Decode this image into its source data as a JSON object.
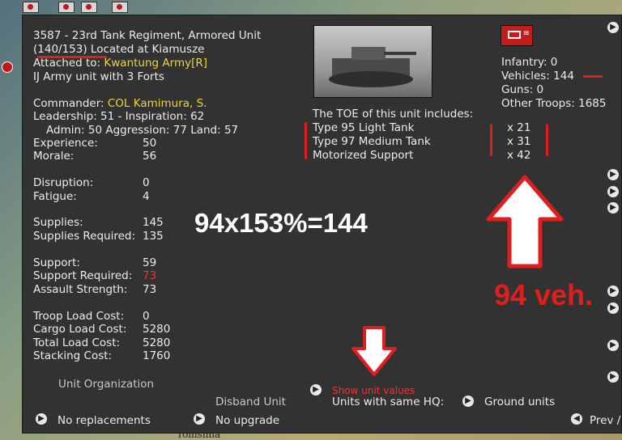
{
  "unit": {
    "line1": "3587 - 23rd Tank Regiment, Armored Unit",
    "line2_strength": "(140/153)",
    "line2_rest": " Located at  Kiamusze",
    "attached_label": "Attached to: ",
    "attached_value": "Kwantung Army[R]",
    "line4": "IJ Army unit with 3 Forts"
  },
  "commander": {
    "label": "Commander: ",
    "value": "COL Kamimura, S.",
    "leadership": "Leadership: 51 - Inspiration: 62",
    "admin": "Admin: 50  Aggression: 77  Land: 57"
  },
  "stats": [
    {
      "label": "Experience:",
      "value": "50"
    },
    {
      "label": "Morale:",
      "value": "56"
    },
    {
      "label": "Disruption:",
      "value": "0"
    },
    {
      "label": "Fatigue:",
      "value": "4"
    },
    {
      "label": "Supplies:",
      "value": "145"
    },
    {
      "label": "Supplies Required:",
      "value": "135"
    },
    {
      "label": "Support:",
      "value": "59"
    },
    {
      "label": "Support Required:",
      "value": "73"
    },
    {
      "label": "Assault Strength:",
      "value": "73"
    },
    {
      "label": "Troop Load Cost:",
      "value": "0"
    },
    {
      "label": "Cargo Load Cost:",
      "value": "5280"
    },
    {
      "label": "Total Load Cost:",
      "value": "5280"
    },
    {
      "label": "Stacking Cost:",
      "value": "1760"
    }
  ],
  "troops": {
    "infantry": "Infantry: 0",
    "vehicles": "Vehicles: 144",
    "guns": "Guns: 0",
    "other": "Other Troops: 1685"
  },
  "toe": {
    "heading": "The TOE of this unit includes:",
    "items": [
      {
        "name": "Type 95 Light Tank",
        "count": "x 21"
      },
      {
        "name": "Type 97 Medium Tank",
        "count": "x 31"
      },
      {
        "name": "Motorized Support",
        "count": "x 42"
      }
    ]
  },
  "annotations": {
    "formula": "94x153%=144",
    "veh": "94 veh."
  },
  "bottom": {
    "unit_org": "Unit Organization",
    "show_values": "Show unit values",
    "disband": "Disband Unit",
    "same_hq": "Units with same HQ:",
    "ground_units": "Ground units",
    "no_replacements": "No replacements",
    "no_upgrade": "No upgrade",
    "prev": "Prev /"
  },
  "map": {
    "town": "Tomsima"
  },
  "colors": {
    "panel_bg": "#323232",
    "highlight_yellow": "#f2d33a",
    "annotation_red": "#e01e1e"
  },
  "icons": [
    "arrow-right-icon",
    "arrow-left-icon",
    "unit-display-icon",
    "down-arrow-annotation-icon",
    "up-arrow-annotation-icon"
  ]
}
